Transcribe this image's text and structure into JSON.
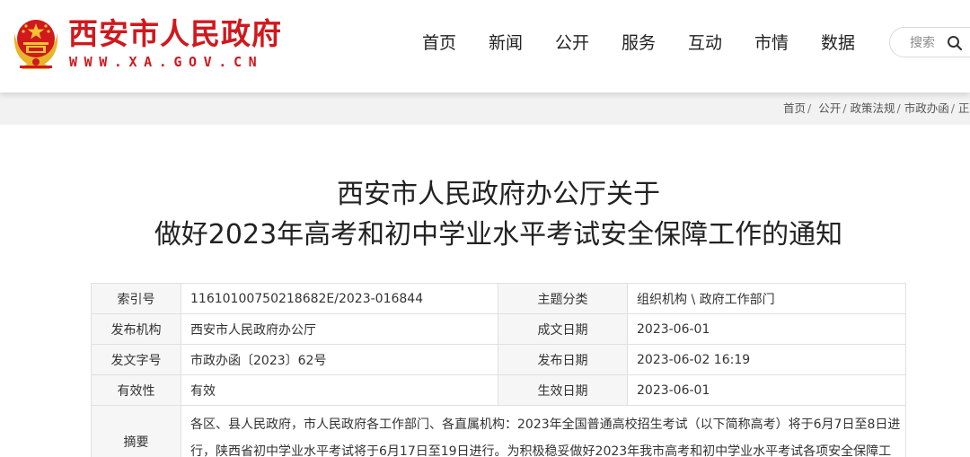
{
  "site": {
    "name": "西安市人民政府",
    "url": "WWW.XA.GOV.CN",
    "colors": {
      "brand": "#d0181d",
      "emblem_gold": "#e8b52a"
    }
  },
  "nav": {
    "items": [
      "首页",
      "新闻",
      "公开",
      "服务",
      "互动",
      "市情",
      "数据"
    ]
  },
  "search": {
    "placeholder": "搜索",
    "icon": "search-icon"
  },
  "breadcrumb": [
    "首页",
    "公开",
    "政策法规",
    "市政办函",
    "正"
  ],
  "document": {
    "title_line1": "西安市人民政府办公厅关于",
    "title_line2": "做好2023年高考和初中学业水平考试安全保障工作的通知"
  },
  "info": {
    "index_label": "索引号",
    "index_value": "11610100750218682E/2023-016844",
    "category_label": "主题分类",
    "category_value": "组织机构 \\ 政府工作部门",
    "publisher_label": "发布机构",
    "publisher_value": "西安市人民政府办公厅",
    "created_label": "成文日期",
    "created_value": "2023-06-01",
    "docno_label": "发文字号",
    "docno_value": "市政办函〔2023〕62号",
    "published_label": "发布日期",
    "published_value": "2023-06-02 16:19",
    "validity_label": "有效性",
    "validity_value": "有效",
    "effective_label": "生效日期",
    "effective_value": "2023-06-01",
    "abstract_label": "摘要",
    "abstract_line1": "各区、县人民政府，市人民政府各工作部门、各直属机构：2023年全国普通高校招生考试（以下简称高考）将于6月7日至8日进",
    "abstract_line2": "行，陕西省初中学业水平考试将于6月17日至19日进行。为积极稳妥做好2023年我市高考和初中学业水平考试各项安全保障工"
  }
}
